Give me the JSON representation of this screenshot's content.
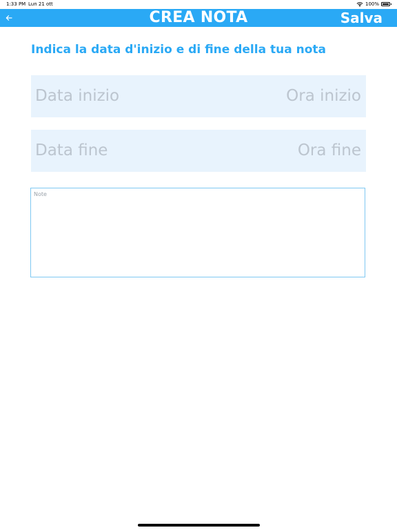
{
  "status_bar": {
    "time": "1:33 PM",
    "date": "Lun 21 ott",
    "battery": "100%"
  },
  "nav": {
    "title": "CREA NOTA",
    "save_label": "Salva",
    "back_icon": "arrow-left-icon"
  },
  "form": {
    "instruction": "Indica la data d'inizio e di fine della tua nota",
    "start": {
      "date_placeholder": "Data inizio",
      "time_placeholder": "Ora inizio"
    },
    "end": {
      "date_placeholder": "Data fine",
      "time_placeholder": "Ora fine"
    },
    "note_placeholder": "Note"
  },
  "colors": {
    "accent": "#2aa9f5",
    "field_background": "#e8f3fd",
    "placeholder_text": "#bcc5cf"
  }
}
